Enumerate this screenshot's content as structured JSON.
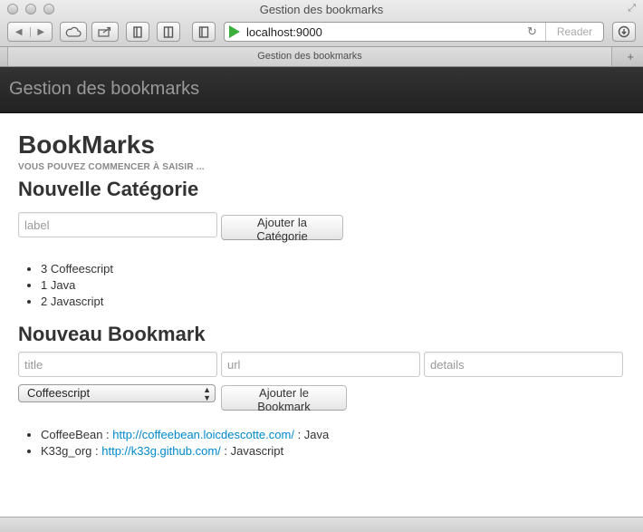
{
  "window": {
    "title": "Gestion des bookmarks"
  },
  "toolbar": {
    "address": "localhost:9000",
    "reader_label": "Reader"
  },
  "tabs": [
    {
      "label": "Gestion des bookmarks"
    }
  ],
  "navbar": {
    "brand": "Gestion des bookmarks"
  },
  "page": {
    "title": "BookMarks",
    "subtitle": "VOUS POUVEZ COMMENCER À SAISIR ...",
    "category_section": {
      "heading": "Nouvelle Catégorie",
      "label_placeholder": "label",
      "add_button": "Ajouter la Catégorie",
      "categories": [
        {
          "text": "3 Coffeescript"
        },
        {
          "text": "1 Java"
        },
        {
          "text": "2 Javascript"
        }
      ]
    },
    "bookmark_section": {
      "heading": "Nouveau Bookmark",
      "title_placeholder": "title",
      "url_placeholder": "url",
      "details_placeholder": "details",
      "selected_category": "Coffeescript",
      "add_button": "Ajouter le Bookmark",
      "bookmarks": [
        {
          "name": "CoffeeBean",
          "sep1": " : ",
          "url": "http://coffeebean.loicdescotte.com/",
          "sep2": " : ",
          "category": "Java"
        },
        {
          "name": "K33g_org",
          "sep1": " : ",
          "url": "http://k33g.github.com/",
          "sep2": " : ",
          "category": "Javascript"
        }
      ]
    }
  }
}
